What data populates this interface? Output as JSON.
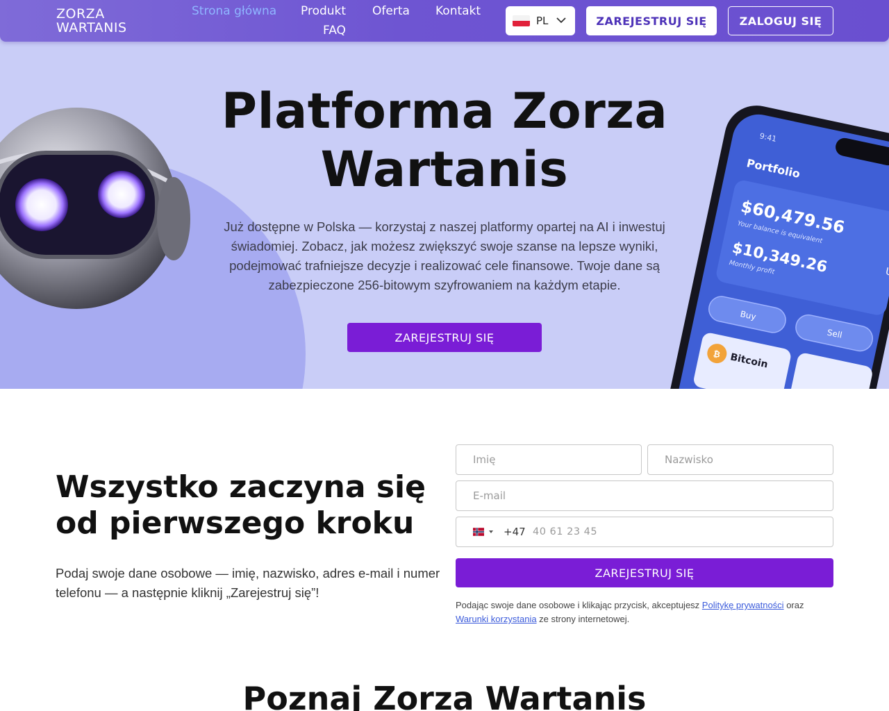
{
  "header": {
    "logo_line1": "ZORZA",
    "logo_line2": "WARTANIS",
    "nav": {
      "home": "Strona główna",
      "product": "Produkt",
      "offer": "Oferta",
      "contact": "Kontakt",
      "faq": "FAQ"
    },
    "language": "PL",
    "register_label": "ZAREJESTRUJ SIĘ",
    "login_label": "ZALOGUJ SIĘ"
  },
  "hero": {
    "title": "Platforma Zorza Wartanis",
    "subtitle": "Już dostępne w Polska — korzystaj z naszej platformy opartej na AI i inwestuj świadomiej. Zobacz, jak możesz zwiększyć swoje szanse na lepsze wyniki, podejmować trafniejsze decyzje i realizować cele finansowe. Twoje dane są zabezpieczone 256-bitowym szyfrowaniem na każdym etapie.",
    "cta_label": "ZAREJESTRUJ SIĘ",
    "phone_mockup": {
      "time": "9:41",
      "heading": "Portfolio",
      "balance": "$60,479.56",
      "balance_note": "Your balance is equivalent",
      "profit": "$10,349.26",
      "profit_note": "Monthly profit",
      "buy_label": "Buy",
      "sell_label": "Sell",
      "asset_name": "Bitcoin",
      "edge_text": "U"
    }
  },
  "signup": {
    "title": "Wszystko zaczyna się od pierwszego kroku",
    "text": "Podaj swoje dane osobowe — imię, nazwisko, adres e-mail i numer telefonu — a następnie kliknij „Zarejestruj się”!",
    "first_name_placeholder": "Imię",
    "last_name_placeholder": "Nazwisko",
    "email_placeholder": "E-mail",
    "dial_code": "+47",
    "phone_placeholder": "40 61 23 45",
    "submit_label": "ZAREJESTRUJ SIĘ",
    "consent_prefix": "Podając swoje dane osobowe i klikając przycisk, akceptujesz ",
    "privacy_link": "Politykę prywatności",
    "consent_mid": " oraz ",
    "terms_link": "Warunki korzystania",
    "consent_suffix": " ze strony internetowej."
  },
  "next_section": {
    "title": "Poznaj Zorza Wartanis"
  },
  "colors": {
    "header_gradient_start": "#7f6bd8",
    "header_gradient_end": "#6a4fd0",
    "hero_bg": "#c9cdf7",
    "accent_purple": "#7a1dd6",
    "nav_active": "#8fb6ff",
    "link_blue": "#3b5bdb"
  }
}
